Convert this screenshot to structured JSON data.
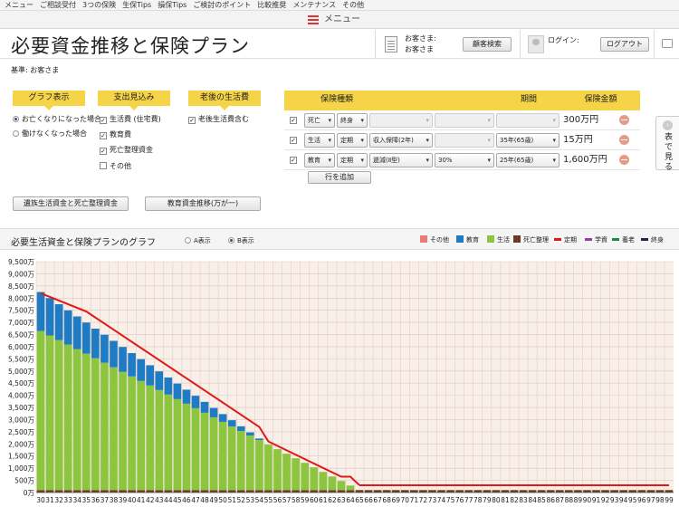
{
  "topnav": [
    "メニュー",
    "ご相談受付",
    "3つの保険",
    "生保Tips",
    "損保Tips",
    "ご検討のポイント",
    "比較推奨",
    "メンテナンス",
    "その他"
  ],
  "menubar": {
    "label": "メニュー",
    "icon": "hamburger-icon"
  },
  "header": {
    "title": "必要資金推移と保険プラン",
    "customer_label": "お客さま:",
    "customer_name": "お客さま",
    "search_button": "顧客検索",
    "login_label": "ログイン:",
    "logout_button": "ログアウト"
  },
  "basis": "基準: お客さま",
  "left": {
    "graph_display": "グラフ表示",
    "expense": "支出見込み",
    "retirement": "老後の生活費",
    "radio1": "お亡くなりになった場合",
    "radio2": "働けなくなった場合",
    "cb1": "生活費 (住宅費)",
    "cb2": "教育費",
    "cb3": "死亡整理資金",
    "cb4": "その他",
    "cb5": "老後生活費含む",
    "btn1": "遺族生活資金と死亡整理資金",
    "btn2": "教育資金推移(万が一)"
  },
  "plan": {
    "col_type": "保険種類",
    "col_period": "期間",
    "col_amount": "保険金額",
    "add_row": "行を追加",
    "rows": [
      {
        "kind": "死亡",
        "term": "終身",
        "sub": "",
        "rate": "",
        "period": "",
        "amount": "300万円"
      },
      {
        "kind": "生活",
        "term": "定期",
        "sub": "収入保障(2年)",
        "rate": "",
        "period": "35年(65歳)",
        "amount": "15万円"
      },
      {
        "kind": "教育",
        "term": "定期",
        "sub": "逓減(Ⅱ型)",
        "rate": "30%",
        "period": "25年(65歳)",
        "amount": "1,600万円"
      }
    ]
  },
  "sidetab": "表で見る",
  "chart_section": {
    "title": "必要生活資金と保険プランのグラフ",
    "optA": "A表示",
    "optB": "B表示",
    "legend": [
      {
        "name": "その他",
        "color": "#e87a7a",
        "kind": "box"
      },
      {
        "name": "教育",
        "color": "#1f7cc4",
        "kind": "box"
      },
      {
        "name": "生活",
        "color": "#8cc63f",
        "kind": "box"
      },
      {
        "name": "死亡整理",
        "color": "#6b3a1f",
        "kind": "box"
      },
      {
        "name": "定期",
        "color": "#e01818",
        "kind": "line"
      },
      {
        "name": "学資",
        "color": "#9a3fa0",
        "kind": "line"
      },
      {
        "name": "養老",
        "color": "#1f8a3a",
        "kind": "line"
      },
      {
        "name": "終身",
        "color": "#1f2a4a",
        "kind": "line"
      }
    ]
  },
  "chart_data": {
    "type": "bar",
    "x_start": 30,
    "x_end": 99,
    "ylim": [
      0,
      9500
    ],
    "y_step": 500,
    "y_unit": "万",
    "life_start": 6550,
    "life_zero_age": 65,
    "edu_start": 1600,
    "edu_zero_age": 55,
    "death_value": 100,
    "teiki_line": [
      [
        30,
        8200
      ],
      [
        35,
        7450
      ],
      [
        54,
        2700
      ],
      [
        55,
        2100
      ],
      [
        63,
        650
      ],
      [
        64,
        650
      ],
      [
        65,
        300
      ]
    ],
    "shushin_line": [
      [
        65,
        300
      ],
      [
        99,
        300
      ]
    ]
  }
}
